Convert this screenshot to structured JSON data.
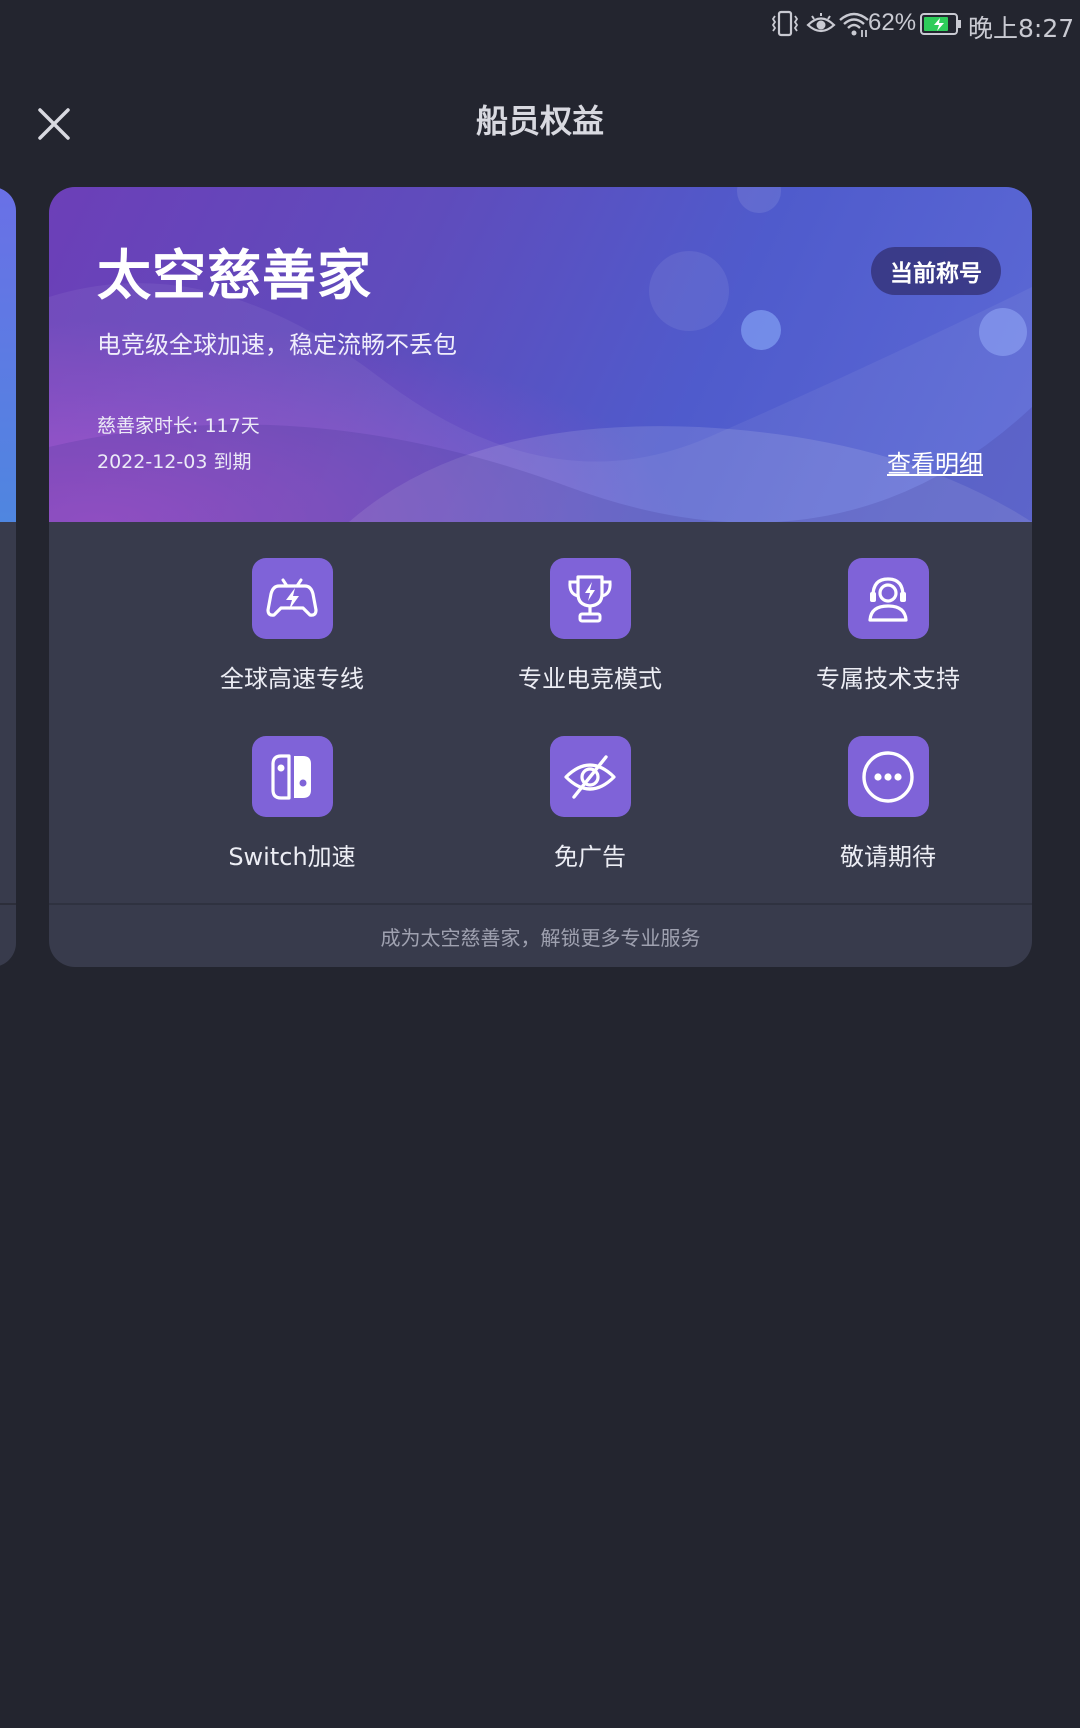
{
  "status_bar": {
    "battery_percent": "62%",
    "time": "晚上8:27",
    "icons": [
      "vibrate-icon",
      "eye-care-icon",
      "wifi-icon",
      "battery-charging-icon"
    ]
  },
  "header": {
    "title": "船员权益",
    "close_icon": "close-icon"
  },
  "card": {
    "tier_name": "太空慈善家",
    "description": "电竞级全球加速，稳定流畅不丢包",
    "badge": "当前称号",
    "duration": "慈善家时长: 117天",
    "expiry": "2022-12-03 到期",
    "details_link": "查看明细",
    "footer": "成为太空慈善家，解锁更多专业服务"
  },
  "features": [
    {
      "label": "全球高速专线",
      "icon": "gamepad-lightning-icon"
    },
    {
      "label": "专业电竞模式",
      "icon": "trophy-icon"
    },
    {
      "label": "专属技术支持",
      "icon": "support-agent-icon"
    },
    {
      "label": "Switch加速",
      "icon": "switch-console-icon"
    },
    {
      "label": "免广告",
      "icon": "eye-off-icon"
    },
    {
      "label": "敬请期待",
      "icon": "more-icon"
    }
  ],
  "colors": {
    "background": "#23252f",
    "card": "#383b4c",
    "icon_tile": "#7f63d8",
    "banner_start": "#6c3fb8",
    "banner_end": "#5d6ad6"
  }
}
